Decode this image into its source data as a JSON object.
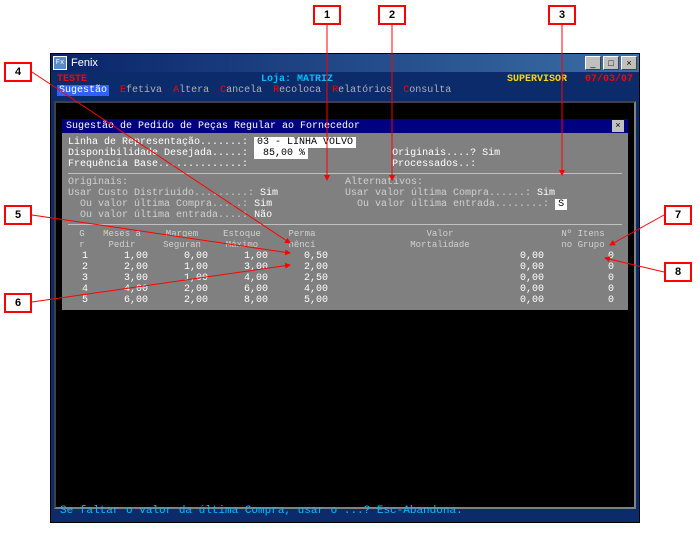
{
  "window": {
    "title": "Fenix"
  },
  "header": {
    "teste": "TESTE",
    "loja": "Loja: MATRIZ",
    "supervisor": "SUPERVISOR",
    "date": "07/03/07"
  },
  "menu": [
    {
      "hot": "S",
      "rest": "ugestão",
      "active": true
    },
    {
      "hot": "E",
      "rest": "fetiva"
    },
    {
      "hot": "A",
      "rest": "ltera"
    },
    {
      "hot": "C",
      "rest": "ancela"
    },
    {
      "hot": "R",
      "rest": "ecoloca"
    },
    {
      "hot": "R",
      "rest": "elatórios"
    },
    {
      "hot": "C",
      "rest": "onsulta"
    }
  ],
  "panel": {
    "title": "Sugestão de Pedido de Peças Regular ao Fornecedor",
    "linha_label": "Linha de Representação.......:",
    "linha_value": "03 - LINHA VOLVO",
    "disp_label": "Disponibilidade Desejada.....:",
    "disp_value": " 85,00 %",
    "freq_label": "Frequência Base..............:",
    "orig_label": "Originais....?",
    "orig_value": "Sim",
    "proc_label": "Processados..:",
    "proc_value": "",
    "section_orig": "Originais:",
    "section_alt": "Alternativos:",
    "orig_usar_custo_label": "Usar Custo Distriuido.........:",
    "orig_usar_custo_value": "Sim",
    "orig_ult_compra_label": "Ou valor última Compra.....:",
    "orig_ult_compra_value": "Sim",
    "orig_ult_entr_label": "Ou valor última entrada....:",
    "orig_ult_entr_value": "Não",
    "alt_ult_compra_label": "Usar valor última Compra......:",
    "alt_ult_compra_value": "Sim",
    "alt_ult_entr_label": "Ou valor última entrada........:",
    "alt_ult_entr_value": "S",
    "table": {
      "headers": {
        "gr": "G\nr",
        "meses": "Meses a\nPedir",
        "margem": "Margem\nSeguran",
        "estoque": "Estoque\nMáximo",
        "perman": "Perma\nnênci",
        "valor": "Valor\nMortalidade",
        "itens": "Nº Itens\nno Grupo"
      },
      "rows": [
        {
          "g": "1",
          "meses": "1,00",
          "margem": "0,00",
          "estoque": "1,00",
          "perm": "0,50",
          "valor": "0,00",
          "itens": "0"
        },
        {
          "g": "2",
          "meses": "2,00",
          "margem": "1,00",
          "estoque": "3,00",
          "perm": "2,00",
          "valor": "0,00",
          "itens": "0"
        },
        {
          "g": "3",
          "meses": "3,00",
          "margem": "1,00",
          "estoque": "4,00",
          "perm": "2,50",
          "valor": "0,00",
          "itens": "0"
        },
        {
          "g": "4",
          "meses": "4,00",
          "margem": "2,00",
          "estoque": "6,00",
          "perm": "4,00",
          "valor": "0,00",
          "itens": "0"
        },
        {
          "g": "5",
          "meses": "6,00",
          "margem": "2,00",
          "estoque": "8,00",
          "perm": "5,00",
          "valor": "0,00",
          "itens": "0"
        }
      ]
    }
  },
  "status": "Se faltar o valor da última Compra, usar o ...? Esc-Abandona.",
  "callouts": {
    "c1": "1",
    "c2": "2",
    "c3": "3",
    "c4": "4",
    "c5": "5",
    "c6": "6",
    "c7": "7",
    "c8": "8"
  }
}
